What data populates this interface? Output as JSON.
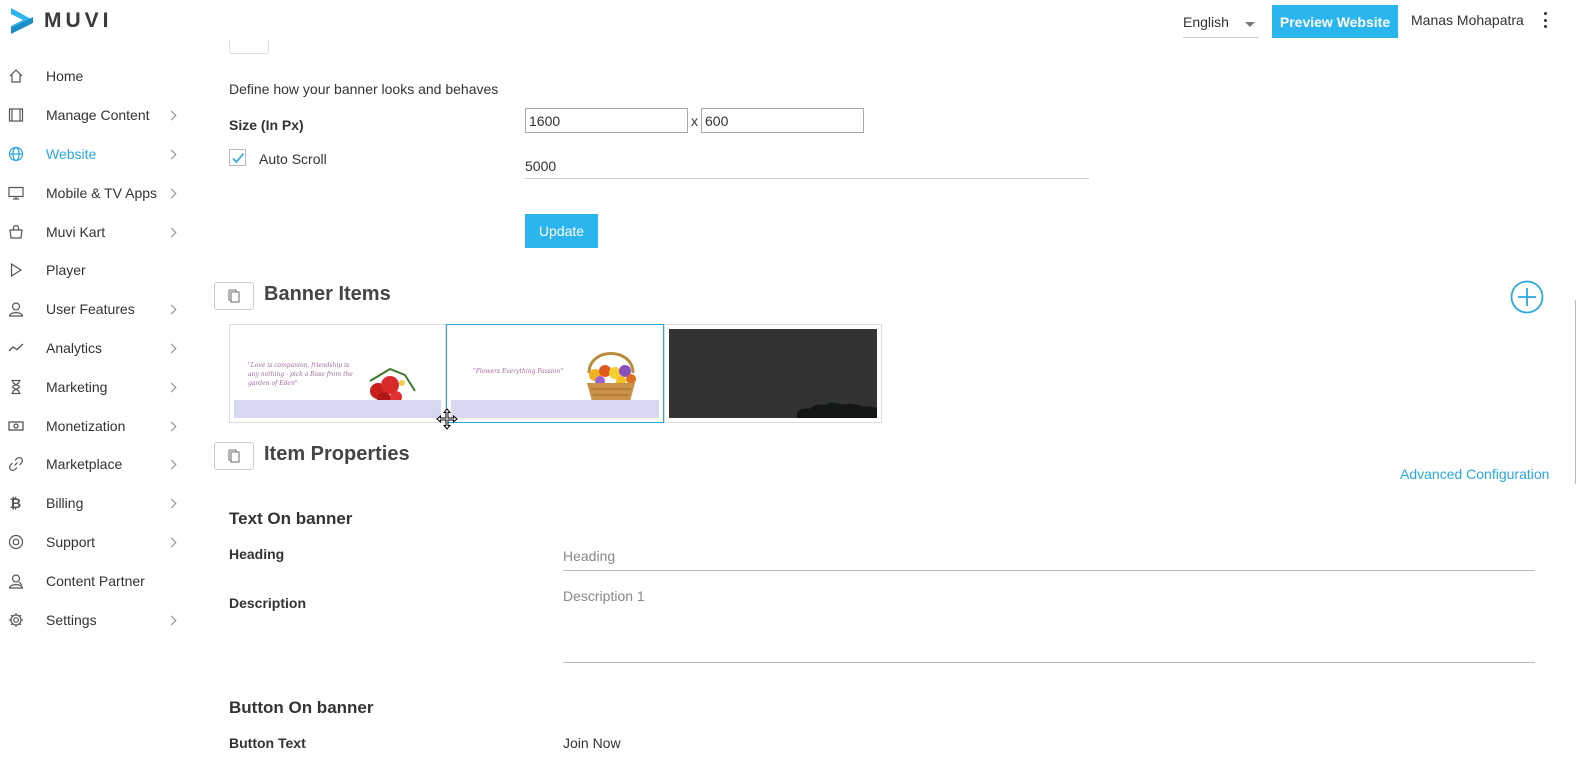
{
  "brand": {
    "name": "MUVI",
    "accent": "#29a8e0"
  },
  "sidebar": {
    "items": [
      {
        "label": "Home",
        "icon": "home-icon",
        "chevron": false,
        "active": false
      },
      {
        "label": "Manage Content",
        "icon": "film-icon",
        "chevron": true,
        "active": false
      },
      {
        "label": "Website",
        "icon": "globe-icon",
        "chevron": true,
        "active": true
      },
      {
        "label": "Mobile & TV Apps",
        "icon": "monitor-icon",
        "chevron": true,
        "active": false
      },
      {
        "label": "Muvi Kart",
        "icon": "shopping-bag-icon",
        "chevron": true,
        "active": false
      },
      {
        "label": "Player",
        "icon": "play-icon",
        "chevron": false,
        "active": false
      },
      {
        "label": "User Features",
        "icon": "user-icon",
        "chevron": true,
        "active": false
      },
      {
        "label": "Analytics",
        "icon": "trend-icon",
        "chevron": true,
        "active": false
      },
      {
        "label": "Marketing",
        "icon": "hourglass-icon",
        "chevron": true,
        "active": false
      },
      {
        "label": "Monetization",
        "icon": "money-icon",
        "chevron": true,
        "active": false
      },
      {
        "label": "Marketplace",
        "icon": "link-icon",
        "chevron": true,
        "active": false
      },
      {
        "label": "Billing",
        "icon": "bitcoin-icon",
        "chevron": true,
        "active": false
      },
      {
        "label": "Support",
        "icon": "lifebuoy-icon",
        "chevron": true,
        "active": false
      },
      {
        "label": "Content Partner",
        "icon": "partner-icon",
        "chevron": false,
        "active": false
      },
      {
        "label": "Settings",
        "icon": "gear-icon",
        "chevron": true,
        "active": false
      }
    ]
  },
  "topbar": {
    "language": "English",
    "preview_label": "Preview Website",
    "user_name": "Manas Mohapatra"
  },
  "banner_settings": {
    "description": "Define how your banner looks and behaves",
    "size_label": "Size (In Px)",
    "width": "1600",
    "separator": "x",
    "height": "600",
    "auto_scroll_label": "Auto Scroll",
    "auto_scroll_checked": true,
    "scroll_interval": "5000",
    "update_label": "Update"
  },
  "banner_items": {
    "title": "Banner Items",
    "thumbnails": [
      {
        "quote": "\"Love is companion, friendship is any nothing - pick a Rose from the garden of Eden\"",
        "selected": false
      },
      {
        "quote": "\"Flowers Everything Passion\"",
        "selected": true
      },
      {
        "quote": "",
        "selected": false
      }
    ]
  },
  "item_properties": {
    "title": "Item Properties",
    "advanced_label": "Advanced Configuration",
    "text_section_title": "Text On banner",
    "heading_label": "Heading",
    "heading_placeholder": "Heading",
    "description_label": "Description",
    "description_placeholder": "Description 1",
    "button_section_title": "Button On banner",
    "button_text_label": "Button Text",
    "button_text_value": "Join Now"
  }
}
